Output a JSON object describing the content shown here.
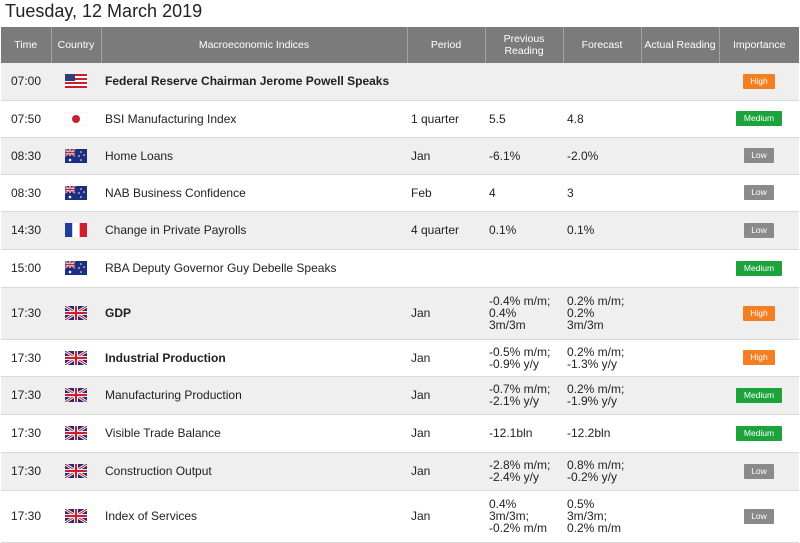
{
  "page": {
    "date_title": "Tuesday, 12 March 2019"
  },
  "columns": {
    "time": "Time",
    "country": "Country",
    "indices": "Macroeconomic Indices",
    "period": "Period",
    "previous": "Previous Reading",
    "forecast": "Forecast",
    "actual": "Actual Reading",
    "importance": "Importance"
  },
  "colors": {
    "high": "#f47f20",
    "medium": "#1da33b",
    "low": "#8a8a8a",
    "header_bg": "#7b7b7b"
  },
  "rows": [
    {
      "time": "07:00",
      "country": "us-flag",
      "event": "Federal Reserve Chairman Jerome Powell Speaks",
      "bold": true,
      "period": "",
      "previous": [
        ""
      ],
      "forecast": [
        ""
      ],
      "actual": "",
      "importance": "High"
    },
    {
      "time": "07:50",
      "country": "japan-flag",
      "event": "BSI Manufacturing Index",
      "bold": false,
      "period": "1 quarter",
      "previous": [
        "5.5"
      ],
      "forecast": [
        "4.8"
      ],
      "actual": "",
      "importance": "Medium"
    },
    {
      "time": "08:30",
      "country": "australia-flag",
      "event": "Home Loans",
      "bold": false,
      "period": "Jan",
      "previous": [
        "-6.1%"
      ],
      "forecast": [
        "-2.0%"
      ],
      "actual": "",
      "importance": "Low"
    },
    {
      "time": "08:30",
      "country": "australia-flag",
      "event": "NAB Business Confidence",
      "bold": false,
      "period": "Feb",
      "previous": [
        "4"
      ],
      "forecast": [
        "3"
      ],
      "actual": "",
      "importance": "Low"
    },
    {
      "time": "14:30",
      "country": "france-flag",
      "event": "Change in Private Payrolls",
      "bold": false,
      "period": "4 quarter",
      "previous": [
        "0.1%"
      ],
      "forecast": [
        "0.1%"
      ],
      "actual": "",
      "importance": "Low"
    },
    {
      "time": "15:00",
      "country": "australia-flag",
      "event": "RBA Deputy Governor Guy Debelle Speaks",
      "bold": false,
      "period": "",
      "previous": [
        ""
      ],
      "forecast": [
        ""
      ],
      "actual": "",
      "importance": "Medium"
    },
    {
      "time": "17:30",
      "country": "uk-flag",
      "event": "GDP",
      "bold": true,
      "period": "Jan",
      "previous": [
        "-0.4% m/m;",
        "0.4%",
        "3m/3m"
      ],
      "forecast": [
        "0.2% m/m;",
        "0.2%",
        "3m/3m"
      ],
      "actual": "",
      "importance": "High"
    },
    {
      "time": "17:30",
      "country": "uk-flag",
      "event": "Industrial Production",
      "bold": true,
      "period": "Jan",
      "previous": [
        "-0.5% m/m;",
        "-0.9% y/y"
      ],
      "forecast": [
        "0.2% m/m;",
        "-1.3% y/y"
      ],
      "actual": "",
      "importance": "High"
    },
    {
      "time": "17:30",
      "country": "uk-flag",
      "event": "Manufacturing Production",
      "bold": false,
      "period": "Jan",
      "previous": [
        "-0.7% m/m;",
        "-2.1% y/y"
      ],
      "forecast": [
        "0.2% m/m;",
        "-1.9% y/y"
      ],
      "actual": "",
      "importance": "Medium"
    },
    {
      "time": "17:30",
      "country": "uk-flag",
      "event": "Visible Trade Balance",
      "bold": false,
      "period": "Jan",
      "previous": [
        "-12.1bln"
      ],
      "forecast": [
        "-12.2bln"
      ],
      "actual": "",
      "importance": "Medium"
    },
    {
      "time": "17:30",
      "country": "uk-flag",
      "event": "Construction Output",
      "bold": false,
      "period": "Jan",
      "previous": [
        "-2.8% m/m;",
        "-2.4% y/y"
      ],
      "forecast": [
        "0.8% m/m;",
        "-0.2% y/y"
      ],
      "actual": "",
      "importance": "Low"
    },
    {
      "time": "17:30",
      "country": "uk-flag",
      "event": "Index of Services",
      "bold": false,
      "period": "Jan",
      "previous": [
        "0.4%",
        "3m/3m;",
        "-0.2% m/m"
      ],
      "forecast": [
        "0.5%",
        "3m/3m;",
        "0.2% m/m"
      ],
      "actual": "",
      "importance": "Low"
    }
  ]
}
